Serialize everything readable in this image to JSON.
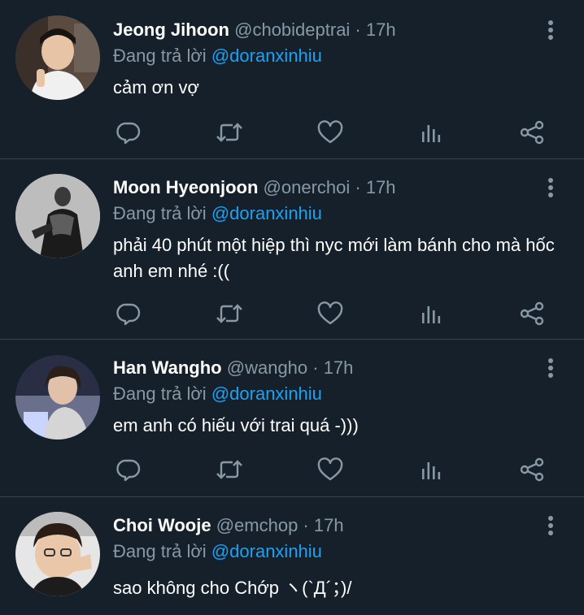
{
  "reply_label": "Đang trả lời",
  "colors": {
    "background": "#15202b",
    "divider": "#38444d",
    "primary_text": "#ffffff",
    "secondary_text": "#8899a6",
    "accent": "#1da1f2"
  },
  "actions": [
    {
      "name": "reply-icon"
    },
    {
      "name": "retweet-icon"
    },
    {
      "name": "like-icon"
    },
    {
      "name": "analytics-icon"
    },
    {
      "name": "share-icon"
    }
  ],
  "tweets": [
    {
      "display_name": "Jeong Jihoon",
      "meta": "@chobideptrai · 17h",
      "mention": "@doranxinhiu",
      "text": "cảm ơn vợ"
    },
    {
      "display_name": "Moon Hyeonjoon",
      "meta": "@onerchoi · 17h",
      "mention": "@doranxinhiu",
      "text": "phải 40 phút một hiệp thì nyc mới làm bánh cho mà hốc anh em nhé :(("
    },
    {
      "display_name": "Han Wangho",
      "meta": "@wangho · 17h",
      "mention": "@doranxinhiu",
      "text": "em anh có hiếu với trai quá -)))"
    },
    {
      "display_name": "Choi Wooje",
      "meta": "@emchop · 17h",
      "mention": "@doranxinhiu",
      "text": "sao không cho Chớp ヽ(`Д´；)/"
    }
  ]
}
